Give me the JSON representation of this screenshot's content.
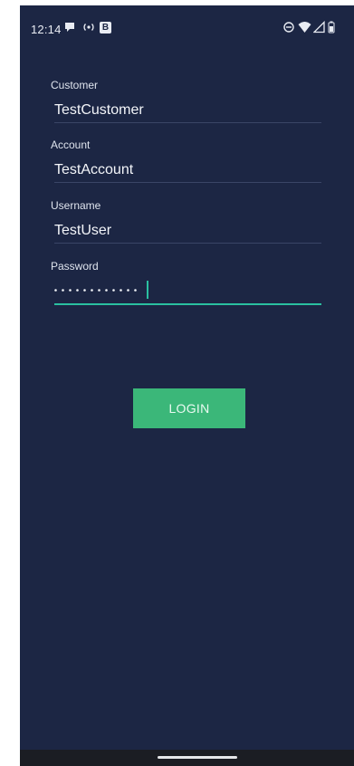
{
  "status_bar": {
    "time": "12:14",
    "badge_letter": "B",
    "icons": [
      "chat-bubble-icon",
      "broadcast-icon",
      "b-badge-icon",
      "do-not-disturb-icon",
      "wifi-icon",
      "signal-icon",
      "battery-icon"
    ]
  },
  "form": {
    "customer": {
      "label": "Customer",
      "value": "TestCustomer"
    },
    "account": {
      "label": "Account",
      "value": "TestAccount"
    },
    "username": {
      "label": "Username",
      "value": "TestUser"
    },
    "password": {
      "label": "Password",
      "masked_value": "••••••••••••"
    }
  },
  "login_button": {
    "label": "LOGIN"
  },
  "colors": {
    "background": "#1c2644",
    "accent": "#2ac0a0",
    "button": "#3bb779",
    "text": "#f3f5f9"
  }
}
